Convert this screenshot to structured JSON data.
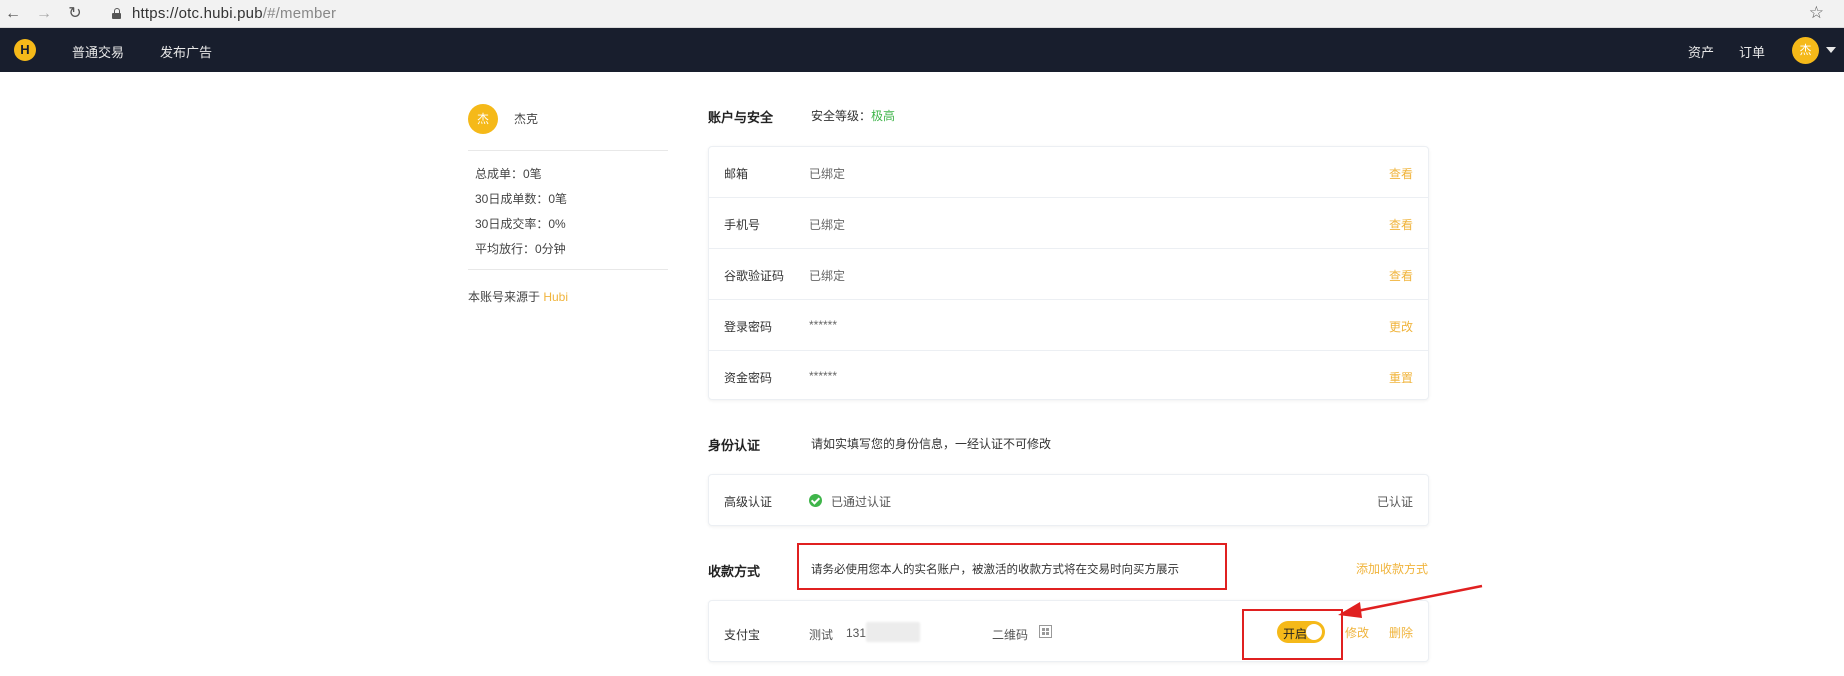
{
  "browser": {
    "url_main": "https://otc.hubi.pub",
    "url_hash": "/#/member",
    "back_glyph": "←",
    "forward_glyph": "→",
    "reload_glyph": "↻",
    "star_glyph": "☆"
  },
  "topnav": {
    "logo_glyph": "H",
    "items": [
      "普通交易",
      "发布广告"
    ],
    "right_items": [
      "资产",
      "订单"
    ],
    "avatar_char": "杰"
  },
  "profile": {
    "avatar_char": "杰",
    "name": "杰克",
    "stats": [
      "总成单：0笔",
      "30日成单数：0笔",
      "30日成交率：0%",
      "平均放行：0分钟"
    ],
    "source_prefix": "本账号来源于 ",
    "source_name": "Hubi"
  },
  "account_security": {
    "title": "账户与安全",
    "level_label": "安全等级：",
    "level_value": "极高",
    "rows": [
      {
        "label": "邮箱",
        "value": "已绑定",
        "action": "查看"
      },
      {
        "label": "手机号",
        "value": "已绑定",
        "action": "查看"
      },
      {
        "label": "谷歌验证码",
        "value": "已绑定",
        "action": "查看"
      },
      {
        "label": "登录密码",
        "value": "******",
        "action": "更改"
      },
      {
        "label": "资金密码",
        "value": "******",
        "action": "重置"
      }
    ]
  },
  "identity": {
    "title": "身份认证",
    "subtitle": "请如实填写您的身份信息，一经认证不可修改",
    "row_label": "高级认证",
    "row_value": "已通过认证",
    "row_status": "已认证"
  },
  "payment": {
    "title": "收款方式",
    "notice": "请务必使用您本人的实名账户，被激活的收款方式将在交易时向买方展示",
    "add_label": "添加收款方式",
    "method": {
      "type": "支付宝",
      "name": "测试",
      "account_visible": "131",
      "qr_label": "二维码",
      "toggle_label": "开启",
      "toggle_on": true,
      "edit_label": "修改",
      "delete_label": "删除"
    }
  },
  "colors": {
    "accent": "#f0b43c",
    "nav_bg": "#181e2d",
    "success": "#3fb54a",
    "annotation": "#e02020"
  }
}
